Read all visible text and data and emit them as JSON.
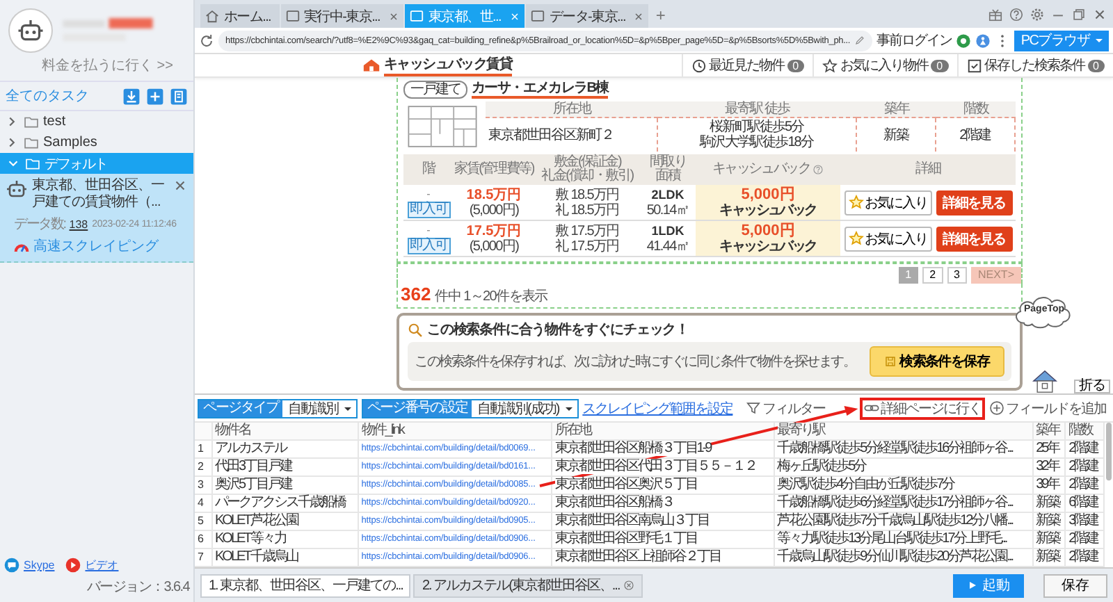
{
  "account": {
    "payment_link": "料金を払うに行く >>"
  },
  "sidebar": {
    "title": "全てのタスク",
    "tree": [
      {
        "label": "test",
        "expanded": false,
        "selected": false
      },
      {
        "label": "Samples",
        "expanded": false,
        "selected": false
      },
      {
        "label": "デフォルト",
        "expanded": true,
        "selected": true,
        "children": [
          {
            "title": "東京都、世田谷区、一戸建ての賃貸物件（...",
            "data_label": "データ数:",
            "data_count": "138",
            "timestamp": "2023-02-24 11:12:46",
            "mode": "高速スクレイピング"
          }
        ]
      }
    ],
    "footer": {
      "links": [
        {
          "label": "Skype",
          "kind": "chat"
        },
        {
          "label": "ビデオ",
          "kind": "video"
        }
      ],
      "version": "バージョン：3.6.4"
    }
  },
  "browser": {
    "tabs": [
      {
        "label": "ホーム...",
        "kind": "home",
        "selected": false,
        "closable": false
      },
      {
        "label": "実行中-東京...",
        "kind": "page",
        "selected": false,
        "closable": true
      },
      {
        "label": "東京都、世...",
        "kind": "page",
        "selected": true,
        "closable": true
      },
      {
        "label": "データ-東京...",
        "kind": "page",
        "selected": false,
        "closable": true
      }
    ],
    "new_tab": "+",
    "url": "https://cbchintai.com/search/?utf8=%E2%9C%93&gaq_cat=building_refine&p%5Brailroad_or_location%5D=&p%5Bper_page%5D=&p%5Bsorts%5D%5Bwith_ph...",
    "login": "事前ログイン",
    "mode_button": "PCブラウザ"
  },
  "page": {
    "logo": "キャッシュバック賃貸",
    "nav": [
      {
        "label": "最近見た物件",
        "count": "0",
        "kind": "clock"
      },
      {
        "label": "お気に入り物件",
        "count": "0",
        "kind": "star"
      },
      {
        "label": "保存した検索条件",
        "count": "0",
        "kind": "save"
      }
    ],
    "property": {
      "type_tag": "一戸建て",
      "name": "カーサ・エメカレラB棟",
      "info_columns": [
        "所在地",
        "最寄駅 徒歩",
        "築年",
        "階数"
      ],
      "info_values": [
        [
          "東京都世田谷区新町２"
        ],
        [
          "桜新町駅徒歩5分",
          "駒沢大学駅徒歩18分"
        ],
        [
          "新築"
        ],
        [
          "2階建"
        ]
      ],
      "room_columns": [
        {
          "lines": [
            "階"
          ],
          "kind": "plain"
        },
        {
          "lines": [
            "家賃(管理費等)"
          ],
          "kind": "plain"
        },
        {
          "lines": [
            "敷金(保証金)",
            "礼金(償却・敷引)"
          ],
          "kind": "plain"
        },
        {
          "lines": [
            "間取り",
            "面積"
          ],
          "kind": "plain"
        },
        {
          "lines": [
            "キャッシュバック"
          ],
          "kind": "help"
        },
        {
          "lines": [
            "詳細"
          ],
          "kind": "plain"
        }
      ],
      "rooms": [
        {
          "floor": "-",
          "status": "即入可",
          "rent": "18.5万円",
          "fee": "(5,000円)",
          "deposit": "敷 18.5万円",
          "key_money": "礼 18.5万円",
          "layout": "2LDK",
          "area": "50.14㎡",
          "cashback": "5,000円",
          "cashback_label": "キャッシュバック",
          "favorite": "お気に入り",
          "detail": "詳細を見る"
        },
        {
          "floor": "-",
          "status": "即入可",
          "rent": "17.5万円",
          "fee": "(5,000円)",
          "deposit": "敷 17.5万円",
          "key_money": "礼 17.5万円",
          "layout": "1LDK",
          "area": "41.44㎡",
          "cashback": "5,000円",
          "cashback_label": "キャッシュバック",
          "favorite": "お気に入り",
          "detail": "詳細を見る"
        }
      ]
    },
    "pagination": [
      {
        "label": "1",
        "selected": true
      },
      {
        "label": "2",
        "selected": false
      },
      {
        "label": "3",
        "selected": false
      },
      {
        "label": "NEXT>",
        "selected": false
      }
    ],
    "result_count": "362",
    "result_text": "件中 1～20件を表示",
    "save_box": {
      "title": "この検索条件に合う物件をすぐにチェック！",
      "text": "この検索条件を保存すれば、次に訪れた時にすぐに同じ条件で物件を探せます。",
      "button": "検索条件を保存"
    },
    "page_top": "PageTop"
  },
  "panel": {
    "collapse_button": "折る",
    "selects": [
      {
        "label": "ページタイプ",
        "value": "自動識別"
      },
      {
        "label": "ページ番号の設定",
        "value": "自動識別(成功)"
      }
    ],
    "range_link": "スクレイピング範囲を設定",
    "actions": [
      {
        "label": "フィルター",
        "kind": "filter",
        "highlighted": false
      },
      {
        "label": "詳細ページに行く",
        "kind": "link",
        "highlighted": true
      },
      {
        "label": "フィールドを追加",
        "kind": "plus",
        "highlighted": false
      }
    ],
    "table": {
      "columns": [
        "物件名",
        "物件_link",
        "所在地",
        "最寄り駅",
        "築年",
        "階数"
      ],
      "rows": [
        {
          "index": "1",
          "cells": [
            "アルカステル",
            "https://cbchintai.com/building/detail/bd0069...",
            "東京都世田谷区船橋３丁目1-9",
            "千歳船橋駅徒歩5分経堂駅徒歩16分祖師ヶ谷...",
            "25年",
            "2階建"
          ]
        },
        {
          "index": "2",
          "cells": [
            "代田3丁目戸建",
            "https://cbchintai.com/building/detail/bd0161...",
            "東京都世田谷区代田３丁目５５－１２",
            "梅ヶ丘駅徒歩5分",
            "32年",
            "2階建"
          ]
        },
        {
          "index": "3",
          "cells": [
            "奥沢5丁目戸建",
            "https://cbchintai.com/building/detail/bd0085...",
            "東京都世田谷区奥沢５丁目",
            "奥沢駅徒歩4分自由が丘駅徒歩7分",
            "39年",
            "2階建"
          ]
        },
        {
          "index": "4",
          "cells": [
            "パークアクシス千歳船橋",
            "https://cbchintai.com/building/detail/bd0920...",
            "東京都世田谷区船橋３",
            "千歳船橋駅徒歩6分経堂駅徒歩17分祖師ヶ谷...",
            "新築",
            "6階建"
          ]
        },
        {
          "index": "5",
          "cells": [
            "KOLET芦花公園",
            "https://cbchintai.com/building/detail/bd0905...",
            "東京都世田谷区南烏山３丁目",
            "芦花公園駅徒歩7分千歳烏山駅徒歩12分八幡...",
            "新築",
            "3階建"
          ]
        },
        {
          "index": "6",
          "cells": [
            "KOLET等々力",
            "https://cbchintai.com/building/detail/bd0906...",
            "東京都世田谷区野毛１丁目",
            "等々力駅徒歩13分尾山台駅徒歩17分上野毛...",
            "新築",
            "2階建"
          ]
        },
        {
          "index": "7",
          "cells": [
            "KOLET千歳烏山",
            "https://cbchintai.com/building/detail/bd0906...",
            "東京都世田谷区上祖師谷２丁目",
            "千歳烏山駅徒歩9分仙川駅徒歩20分芦花公園...",
            "新築",
            "2階建"
          ]
        }
      ]
    }
  },
  "task_tabs": [
    {
      "label": "1. 東京都、世田谷区、一戸建ての...",
      "selected": true,
      "closable": false
    },
    {
      "label": "2. アルカステル(東京都世田谷区、...",
      "selected": false,
      "closable": true
    }
  ],
  "run_button": "起動",
  "save_button": "保存"
}
